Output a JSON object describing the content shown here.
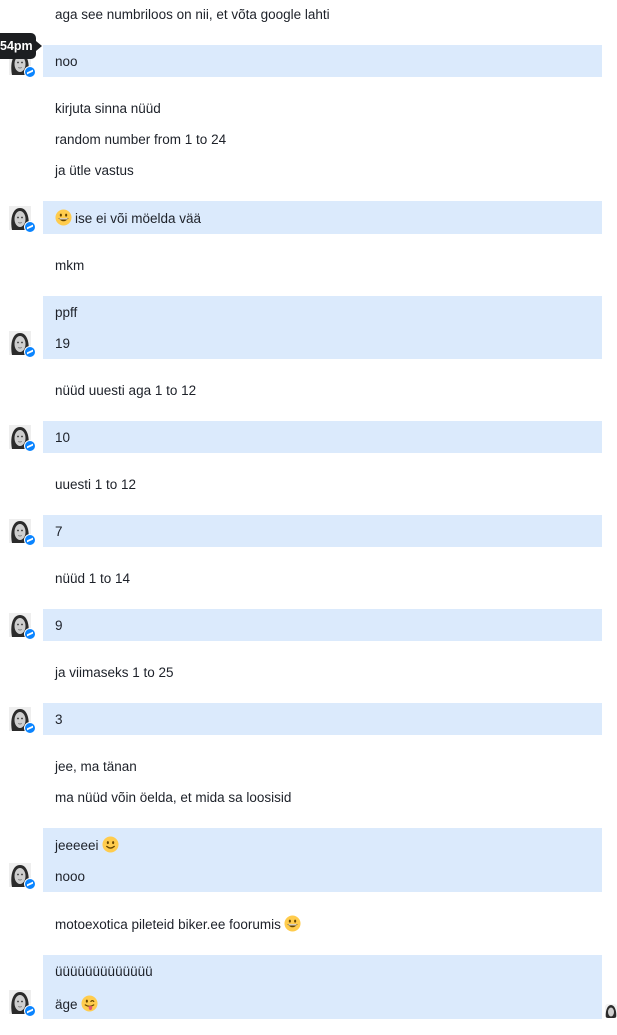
{
  "tooltip": {
    "time": "54pm"
  },
  "messages": [
    {
      "text": "aga see numbriloos on nii, et võta google lahti"
    },
    {
      "text": "noo"
    },
    {
      "text": "kirjuta sinna nüüd"
    },
    {
      "text": "random number from 1 to 24"
    },
    {
      "text": "ja ütle vastus"
    },
    {
      "text": "ise ei või möelda vää",
      "emoji": "grinning-face"
    },
    {
      "text": "mkm"
    },
    {
      "text": "ppff"
    },
    {
      "text": "19"
    },
    {
      "text": "nüüd uuesti aga 1 to 12"
    },
    {
      "text": "10"
    },
    {
      "text": "uuesti 1 to 12"
    },
    {
      "text": "7"
    },
    {
      "text": "nüüd 1 to 14"
    },
    {
      "text": "9"
    },
    {
      "text": "ja viimaseks 1 to 25"
    },
    {
      "text": "3"
    },
    {
      "text": "jee, ma tänan"
    },
    {
      "text": "ma nüüd võin öelda, et mida sa loosisid"
    },
    {
      "text": "jeeeeei",
      "emoji": "slightly-smiling-face"
    },
    {
      "text": "nooo"
    },
    {
      "text": "motoexotica pileteid biker.ee foorumis",
      "emoji": "grinning-face"
    },
    {
      "text": "üüüüüüüüüüüüü"
    },
    {
      "text": "äge",
      "emoji": "face-with-tongue"
    }
  ],
  "colors": {
    "highlight": "#dbeafc",
    "badge": "#0a84ff",
    "emoji": "#ffcc4d",
    "tooltip_bg": "#1c1e21"
  },
  "icons": {
    "avatar": "contact-avatar-photo",
    "badge": "messenger-badge-icon",
    "seen": "seen-avatar-icon"
  }
}
